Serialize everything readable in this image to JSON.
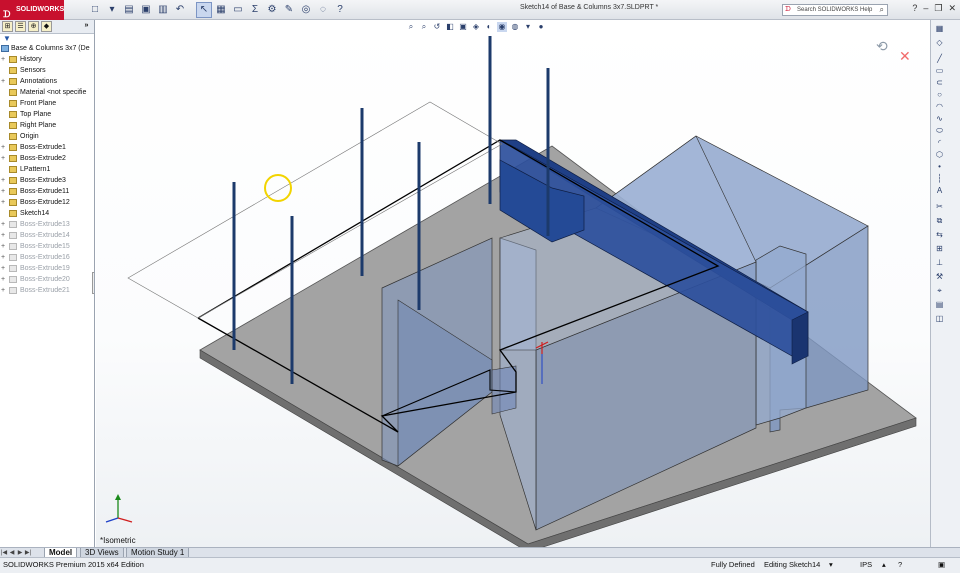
{
  "app": {
    "brand": "SOLIDWORKS",
    "document_title": "Sketch14 of Base & Columns 3x7.SLDPRT *",
    "search_placeholder": "Search SOLIDWORKS Help"
  },
  "feature_tree": {
    "root": "Base & Columns 3x7  (De",
    "items": [
      {
        "label": "History",
        "expand": "+",
        "state": "normal"
      },
      {
        "label": "Sensors",
        "expand": "",
        "state": "normal"
      },
      {
        "label": "Annotations",
        "expand": "+",
        "state": "normal"
      },
      {
        "label": "Material <not specifie",
        "expand": "",
        "state": "normal"
      },
      {
        "label": "Front Plane",
        "expand": "",
        "state": "normal"
      },
      {
        "label": "Top Plane",
        "expand": "",
        "state": "normal"
      },
      {
        "label": "Right Plane",
        "expand": "",
        "state": "normal"
      },
      {
        "label": "Origin",
        "expand": "",
        "state": "normal"
      },
      {
        "label": "Boss-Extrude1",
        "expand": "+",
        "state": "normal"
      },
      {
        "label": "Boss-Extrude2",
        "expand": "+",
        "state": "normal"
      },
      {
        "label": "LPattern1",
        "expand": "",
        "state": "normal"
      },
      {
        "label": "Boss-Extrude3",
        "expand": "+",
        "state": "normal"
      },
      {
        "label": "Boss-Extrude11",
        "expand": "+",
        "state": "normal"
      },
      {
        "label": "Boss-Extrude12",
        "expand": "+",
        "state": "normal"
      },
      {
        "label": "Sketch14",
        "expand": "",
        "state": "normal"
      },
      {
        "label": "Boss-Extrude13",
        "expand": "+",
        "state": "dim"
      },
      {
        "label": "Boss-Extrude14",
        "expand": "+",
        "state": "dim"
      },
      {
        "label": "Boss-Extrude15",
        "expand": "+",
        "state": "dim"
      },
      {
        "label": "Boss-Extrude16",
        "expand": "+",
        "state": "dim"
      },
      {
        "label": "Boss-Extrude19",
        "expand": "+",
        "state": "dim"
      },
      {
        "label": "Boss-Extrude20",
        "expand": "+",
        "state": "dim"
      },
      {
        "label": "Boss-Extrude21",
        "expand": "+",
        "state": "dim"
      }
    ]
  },
  "viewport": {
    "view_label": "*Isometric"
  },
  "bottom_tabs": {
    "model": "Model",
    "views_3d": "3D Views",
    "motion_study": "Motion Study 1"
  },
  "status_bar": {
    "edition": "SOLIDWORKS Premium 2015 x64 Edition",
    "definition": "Fully Defined",
    "editing": "Editing Sketch14",
    "units": "IPS"
  },
  "colors": {
    "brand_red": "#c8102e",
    "solid_blue": "#3b5d9c",
    "base_gray": "#9e9e9e"
  }
}
